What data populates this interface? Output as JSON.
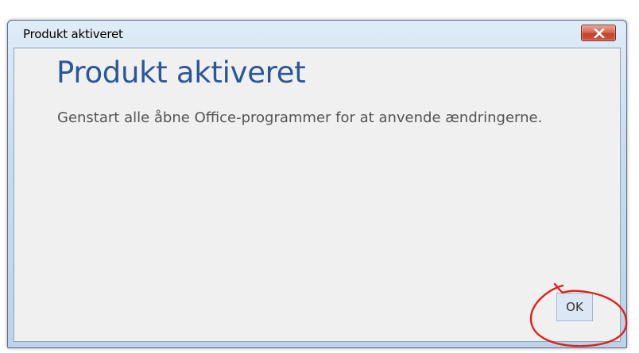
{
  "window": {
    "title": "Produkt aktiveret"
  },
  "dialog": {
    "heading": "Produkt aktiveret",
    "message": "Genstart alle åbne Office-programmer for at anvende ændringerne.",
    "ok_label": "OK"
  },
  "icons": {
    "close": "close-icon"
  },
  "colors": {
    "heading": "#2b5797",
    "annotation": "#e0201b",
    "close_button": "#c4402a"
  }
}
